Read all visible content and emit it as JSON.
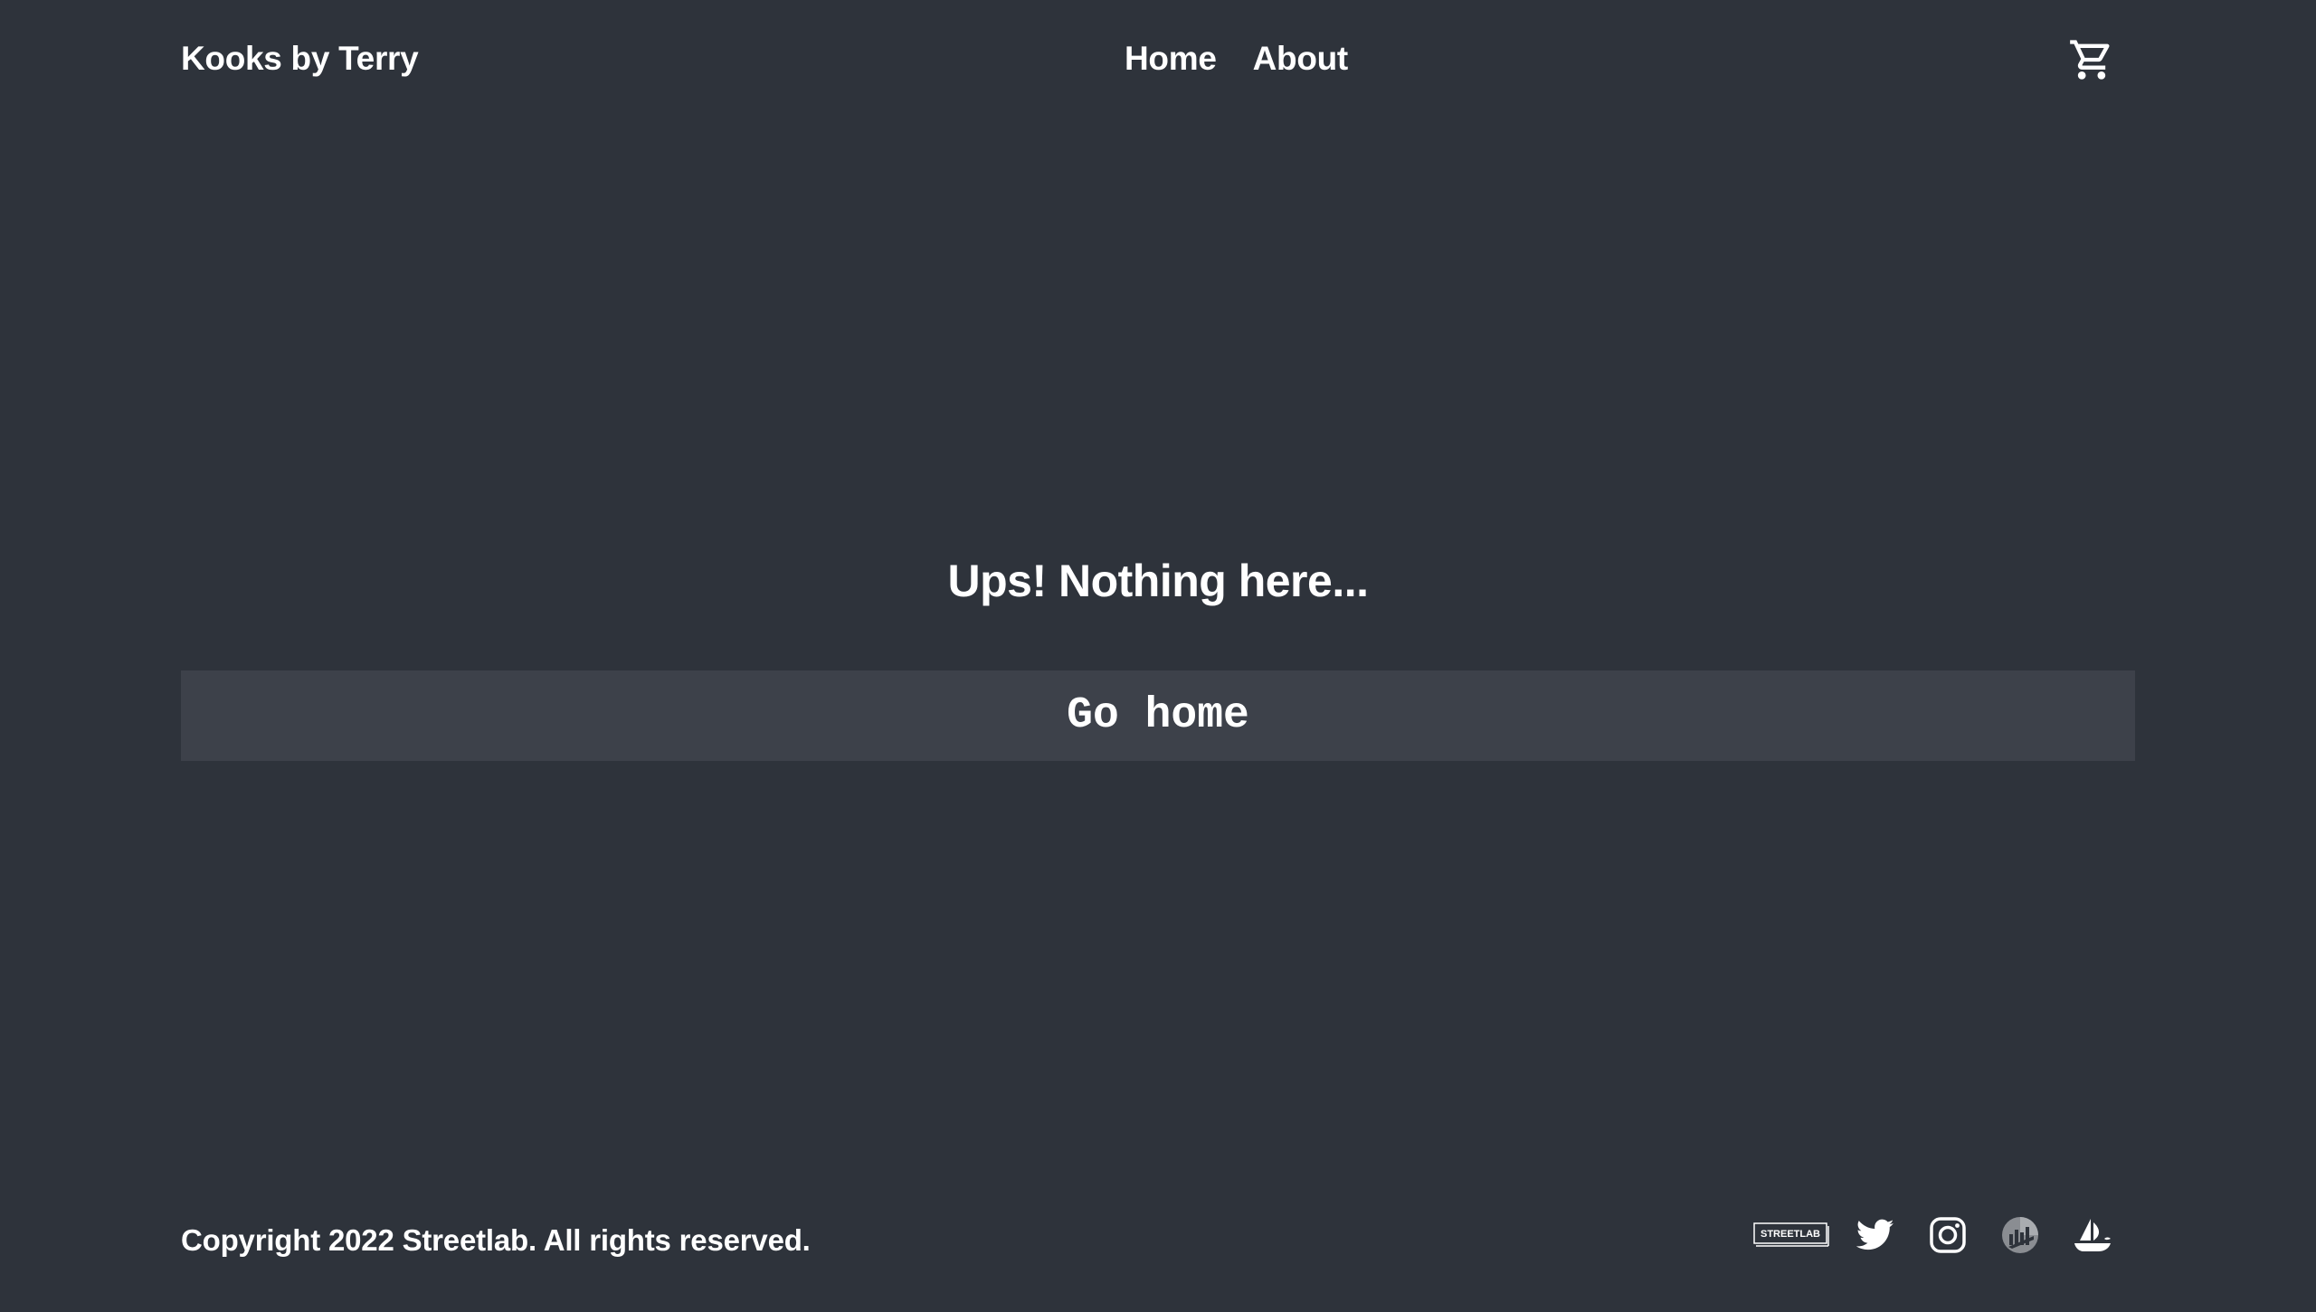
{
  "header": {
    "brand": "Kooks by Terry",
    "nav": [
      {
        "label": "Home"
      },
      {
        "label": "About"
      }
    ],
    "cart_icon": "shopping-cart-icon"
  },
  "main": {
    "title": "Ups! Nothing here...",
    "button_label": "Go home"
  },
  "footer": {
    "copyright": "Copyright 2022 Streetlab. All rights reserved.",
    "socials": [
      {
        "icon": "streetlab-logo-icon",
        "text": "STREETLAB"
      },
      {
        "icon": "twitter-icon"
      },
      {
        "icon": "instagram-icon"
      },
      {
        "icon": "chart-logo-icon"
      },
      {
        "icon": "opensea-boat-icon"
      }
    ]
  },
  "colors": {
    "background": "#2e333b",
    "button_background": "#3d414a",
    "text": "#ffffff"
  }
}
